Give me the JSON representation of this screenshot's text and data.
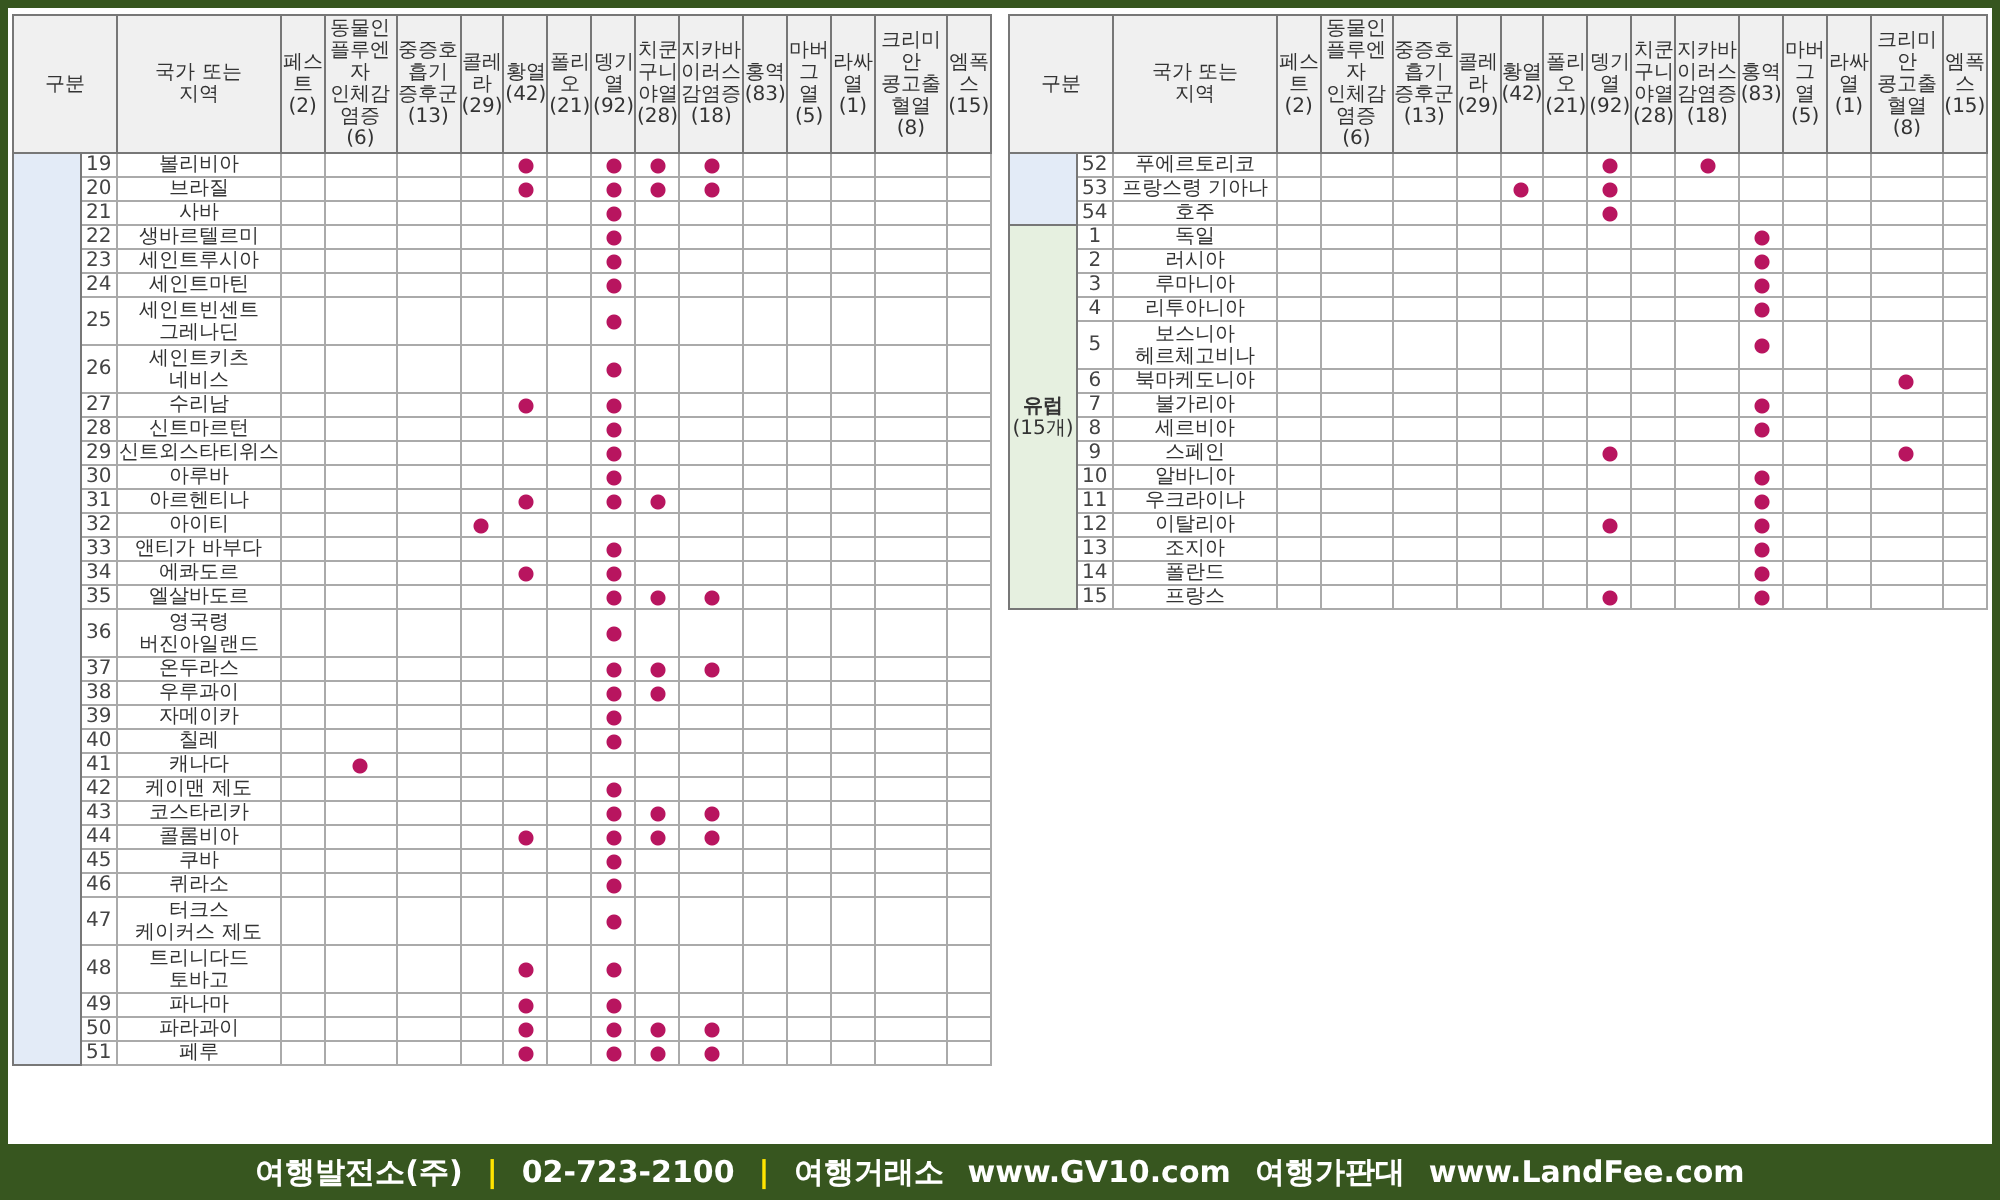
{
  "tables": [
    {
      "header": {
        "group": "구분",
        "region": [
          "국가 또는",
          "지역"
        ],
        "diseases": [
          {
            "name": [
              "페스트"
            ],
            "count": "(2)"
          },
          {
            "name": [
              "동물인플루엔자",
              "인체감염증"
            ],
            "count": "(6)"
          },
          {
            "name": [
              "중증호흡기",
              "증후군"
            ],
            "count": "(13)"
          },
          {
            "name": [
              "콜레라"
            ],
            "count": "(29)"
          },
          {
            "name": [
              "황열"
            ],
            "count": "(42)"
          },
          {
            "name": [
              "폴리오"
            ],
            "count": "(21)"
          },
          {
            "name": [
              "뎅기열"
            ],
            "count": "(92)"
          },
          {
            "name": [
              "치쿤",
              "구니야열"
            ],
            "count": "(28)"
          },
          {
            "name": [
              "지카바이러스",
              "감염증"
            ],
            "count": "(18)"
          },
          {
            "name": [
              "홍역"
            ],
            "count": "(83)"
          },
          {
            "name": [
              "마버그",
              "열"
            ],
            "count": "(5)"
          },
          {
            "name": [
              "라싸열"
            ],
            "count": "(1)"
          },
          {
            "name": [
              "크리미안",
              "콩고출혈열"
            ],
            "count": "(8)"
          },
          {
            "name": [
              "엠폭스"
            ],
            "count": "(15)"
          }
        ]
      },
      "groups": [
        {
          "color": "#e3ebf7",
          "rows": [
            {
              "no": "19",
              "region": [
                "볼리비아"
              ],
              "marked": [
                false,
                false,
                false,
                false,
                true,
                false,
                true,
                true,
                true,
                false,
                false,
                false,
                false,
                false
              ]
            },
            {
              "no": "20",
              "region": [
                "브라질"
              ],
              "marked": [
                false,
                false,
                false,
                false,
                true,
                false,
                true,
                true,
                true,
                false,
                false,
                false,
                false,
                false
              ]
            },
            {
              "no": "21",
              "region": [
                "사바"
              ],
              "marked": [
                false,
                false,
                false,
                false,
                false,
                false,
                true,
                false,
                false,
                false,
                false,
                false,
                false,
                false
              ]
            },
            {
              "no": "22",
              "region": [
                "생바르텔르미"
              ],
              "marked": [
                false,
                false,
                false,
                false,
                false,
                false,
                true,
                false,
                false,
                false,
                false,
                false,
                false,
                false
              ]
            },
            {
              "no": "23",
              "region": [
                "세인트루시아"
              ],
              "marked": [
                false,
                false,
                false,
                false,
                false,
                false,
                true,
                false,
                false,
                false,
                false,
                false,
                false,
                false
              ]
            },
            {
              "no": "24",
              "region": [
                "세인트마틴"
              ],
              "marked": [
                false,
                false,
                false,
                false,
                false,
                false,
                true,
                false,
                false,
                false,
                false,
                false,
                false,
                false
              ]
            },
            {
              "no": "25",
              "region": [
                "세인트빈센트",
                "그레나딘"
              ],
              "marked": [
                false,
                false,
                false,
                false,
                false,
                false,
                true,
                false,
                false,
                false,
                false,
                false,
                false,
                false
              ]
            },
            {
              "no": "26",
              "region": [
                "세인트키츠",
                "네비스"
              ],
              "marked": [
                false,
                false,
                false,
                false,
                false,
                false,
                true,
                false,
                false,
                false,
                false,
                false,
                false,
                false
              ]
            },
            {
              "no": "27",
              "region": [
                "수리남"
              ],
              "marked": [
                false,
                false,
                false,
                false,
                true,
                false,
                true,
                false,
                false,
                false,
                false,
                false,
                false,
                false
              ]
            },
            {
              "no": "28",
              "region": [
                "신트마르턴"
              ],
              "marked": [
                false,
                false,
                false,
                false,
                false,
                false,
                true,
                false,
                false,
                false,
                false,
                false,
                false,
                false
              ]
            },
            {
              "no": "29",
              "region": [
                "신트외스타티위스"
              ],
              "marked": [
                false,
                false,
                false,
                false,
                false,
                false,
                true,
                false,
                false,
                false,
                false,
                false,
                false,
                false
              ]
            },
            {
              "no": "30",
              "region": [
                "아루바"
              ],
              "marked": [
                false,
                false,
                false,
                false,
                false,
                false,
                true,
                false,
                false,
                false,
                false,
                false,
                false,
                false
              ]
            },
            {
              "no": "31",
              "region": [
                "아르헨티나"
              ],
              "marked": [
                false,
                false,
                false,
                false,
                true,
                false,
                true,
                true,
                false,
                false,
                false,
                false,
                false,
                false
              ]
            },
            {
              "no": "32",
              "region": [
                "아이티"
              ],
              "marked": [
                false,
                false,
                false,
                true,
                false,
                false,
                false,
                false,
                false,
                false,
                false,
                false,
                false,
                false
              ]
            },
            {
              "no": "33",
              "region": [
                "앤티가 바부다"
              ],
              "marked": [
                false,
                false,
                false,
                false,
                false,
                false,
                true,
                false,
                false,
                false,
                false,
                false,
                false,
                false
              ]
            },
            {
              "no": "34",
              "region": [
                "에콰도르"
              ],
              "marked": [
                false,
                false,
                false,
                false,
                true,
                false,
                true,
                false,
                false,
                false,
                false,
                false,
                false,
                false
              ]
            },
            {
              "no": "35",
              "region": [
                "엘살바도르"
              ],
              "marked": [
                false,
                false,
                false,
                false,
                false,
                false,
                true,
                true,
                true,
                false,
                false,
                false,
                false,
                false
              ]
            },
            {
              "no": "36",
              "region": [
                "영국령",
                "버진아일랜드"
              ],
              "marked": [
                false,
                false,
                false,
                false,
                false,
                false,
                true,
                false,
                false,
                false,
                false,
                false,
                false,
                false
              ]
            },
            {
              "no": "37",
              "region": [
                "온두라스"
              ],
              "marked": [
                false,
                false,
                false,
                false,
                false,
                false,
                true,
                true,
                true,
                false,
                false,
                false,
                false,
                false
              ]
            },
            {
              "no": "38",
              "region": [
                "우루과이"
              ],
              "marked": [
                false,
                false,
                false,
                false,
                false,
                false,
                true,
                true,
                false,
                false,
                false,
                false,
                false,
                false
              ]
            },
            {
              "no": "39",
              "region": [
                "자메이카"
              ],
              "marked": [
                false,
                false,
                false,
                false,
                false,
                false,
                true,
                false,
                false,
                false,
                false,
                false,
                false,
                false
              ]
            },
            {
              "no": "40",
              "region": [
                "칠레"
              ],
              "marked": [
                false,
                false,
                false,
                false,
                false,
                false,
                true,
                false,
                false,
                false,
                false,
                false,
                false,
                false
              ]
            },
            {
              "no": "41",
              "region": [
                "캐나다"
              ],
              "marked": [
                false,
                true,
                false,
                false,
                false,
                false,
                false,
                false,
                false,
                false,
                false,
                false,
                false,
                false
              ]
            },
            {
              "no": "42",
              "region": [
                "케이맨 제도"
              ],
              "marked": [
                false,
                false,
                false,
                false,
                false,
                false,
                true,
                false,
                false,
                false,
                false,
                false,
                false,
                false
              ]
            },
            {
              "no": "43",
              "region": [
                "코스타리카"
              ],
              "marked": [
                false,
                false,
                false,
                false,
                false,
                false,
                true,
                true,
                true,
                false,
                false,
                false,
                false,
                false
              ]
            },
            {
              "no": "44",
              "region": [
                "콜롬비아"
              ],
              "marked": [
                false,
                false,
                false,
                false,
                true,
                false,
                true,
                true,
                true,
                false,
                false,
                false,
                false,
                false
              ]
            },
            {
              "no": "45",
              "region": [
                "쿠바"
              ],
              "marked": [
                false,
                false,
                false,
                false,
                false,
                false,
                true,
                false,
                false,
                false,
                false,
                false,
                false,
                false
              ]
            },
            {
              "no": "46",
              "region": [
                "퀴라소"
              ],
              "marked": [
                false,
                false,
                false,
                false,
                false,
                false,
                true,
                false,
                false,
                false,
                false,
                false,
                false,
                false
              ]
            },
            {
              "no": "47",
              "region": [
                "터크스",
                "케이커스 제도"
              ],
              "marked": [
                false,
                false,
                false,
                false,
                false,
                false,
                true,
                false,
                false,
                false,
                false,
                false,
                false,
                false
              ]
            },
            {
              "no": "48",
              "region": [
                "트리니다드",
                "토바고"
              ],
              "marked": [
                false,
                false,
                false,
                false,
                true,
                false,
                true,
                false,
                false,
                false,
                false,
                false,
                false,
                false
              ]
            },
            {
              "no": "49",
              "region": [
                "파나마"
              ],
              "marked": [
                false,
                false,
                false,
                false,
                true,
                false,
                true,
                false,
                false,
                false,
                false,
                false,
                false,
                false
              ]
            },
            {
              "no": "50",
              "region": [
                "파라과이"
              ],
              "marked": [
                false,
                false,
                false,
                false,
                true,
                false,
                true,
                true,
                true,
                false,
                false,
                false,
                false,
                false
              ]
            },
            {
              "no": "51",
              "region": [
                "페루"
              ],
              "marked": [
                false,
                false,
                false,
                false,
                true,
                false,
                true,
                true,
                true,
                false,
                false,
                false,
                false,
                false
              ]
            }
          ]
        }
      ]
    },
    {
      "header": {
        "group": "구분",
        "region": [
          "국가 또는",
          "지역"
        ],
        "diseases": [
          {
            "name": [
              "페스트"
            ],
            "count": "(2)"
          },
          {
            "name": [
              "동물인플루엔자",
              "인체감염증"
            ],
            "count": "(6)"
          },
          {
            "name": [
              "중증호흡기",
              "증후군"
            ],
            "count": "(13)"
          },
          {
            "name": [
              "콜레라"
            ],
            "count": "(29)"
          },
          {
            "name": [
              "황열"
            ],
            "count": "(42)"
          },
          {
            "name": [
              "폴리오"
            ],
            "count": "(21)"
          },
          {
            "name": [
              "뎅기열"
            ],
            "count": "(92)"
          },
          {
            "name": [
              "치쿤",
              "구니야열"
            ],
            "count": "(28)"
          },
          {
            "name": [
              "지카바이러스",
              "감염증"
            ],
            "count": "(18)"
          },
          {
            "name": [
              "홍역"
            ],
            "count": "(83)"
          },
          {
            "name": [
              "마버그",
              "열"
            ],
            "count": "(5)"
          },
          {
            "name": [
              "라싸열"
            ],
            "count": "(1)"
          },
          {
            "name": [
              "크리미안",
              "콩고출혈열"
            ],
            "count": "(8)"
          },
          {
            "name": [
              "엠폭스"
            ],
            "count": "(15)"
          }
        ]
      },
      "groups": [
        {
          "color": "#e3ebf7",
          "rows": [
            {
              "no": "52",
              "region": [
                "푸에르토리코"
              ],
              "marked": [
                false,
                false,
                false,
                false,
                false,
                false,
                true,
                false,
                true,
                false,
                false,
                false,
                false,
                false
              ]
            },
            {
              "no": "53",
              "region": [
                "프랑스령 기아나"
              ],
              "marked": [
                false,
                false,
                false,
                false,
                true,
                false,
                true,
                false,
                false,
                false,
                false,
                false,
                false,
                false
              ]
            },
            {
              "no": "54",
              "region": [
                "호주"
              ],
              "marked": [
                false,
                false,
                false,
                false,
                false,
                false,
                true,
                false,
                false,
                false,
                false,
                false,
                false,
                false
              ]
            }
          ]
        },
        {
          "color": "#e6f0e0",
          "label": "유럽",
          "sublabel": "(15개)",
          "rows": [
            {
              "no": "1",
              "region": [
                "독일"
              ],
              "marked": [
                false,
                false,
                false,
                false,
                false,
                false,
                false,
                false,
                false,
                true,
                false,
                false,
                false,
                false
              ]
            },
            {
              "no": "2",
              "region": [
                "러시아"
              ],
              "marked": [
                false,
                false,
                false,
                false,
                false,
                false,
                false,
                false,
                false,
                true,
                false,
                false,
                false,
                false
              ]
            },
            {
              "no": "3",
              "region": [
                "루마니아"
              ],
              "marked": [
                false,
                false,
                false,
                false,
                false,
                false,
                false,
                false,
                false,
                true,
                false,
                false,
                false,
                false
              ]
            },
            {
              "no": "4",
              "region": [
                "리투아니아"
              ],
              "marked": [
                false,
                false,
                false,
                false,
                false,
                false,
                false,
                false,
                false,
                true,
                false,
                false,
                false,
                false
              ]
            },
            {
              "no": "5",
              "region": [
                "보스니아",
                "헤르체고비나"
              ],
              "marked": [
                false,
                false,
                false,
                false,
                false,
                false,
                false,
                false,
                false,
                true,
                false,
                false,
                false,
                false
              ]
            },
            {
              "no": "6",
              "region": [
                "북마케도니아"
              ],
              "marked": [
                false,
                false,
                false,
                false,
                false,
                false,
                false,
                false,
                false,
                false,
                false,
                false,
                true,
                false
              ]
            },
            {
              "no": "7",
              "region": [
                "불가리아"
              ],
              "marked": [
                false,
                false,
                false,
                false,
                false,
                false,
                false,
                false,
                false,
                true,
                false,
                false,
                false,
                false
              ]
            },
            {
              "no": "8",
              "region": [
                "세르비아"
              ],
              "marked": [
                false,
                false,
                false,
                false,
                false,
                false,
                false,
                false,
                false,
                true,
                false,
                false,
                false,
                false
              ]
            },
            {
              "no": "9",
              "region": [
                "스페인"
              ],
              "marked": [
                false,
                false,
                false,
                false,
                false,
                false,
                true,
                false,
                false,
                false,
                false,
                false,
                true,
                false
              ]
            },
            {
              "no": "10",
              "region": [
                "알바니아"
              ],
              "marked": [
                false,
                false,
                false,
                false,
                false,
                false,
                false,
                false,
                false,
                true,
                false,
                false,
                false,
                false
              ]
            },
            {
              "no": "11",
              "region": [
                "우크라이나"
              ],
              "marked": [
                false,
                false,
                false,
                false,
                false,
                false,
                false,
                false,
                false,
                true,
                false,
                false,
                false,
                false
              ]
            },
            {
              "no": "12",
              "region": [
                "이탈리아"
              ],
              "marked": [
                false,
                false,
                false,
                false,
                false,
                false,
                true,
                false,
                false,
                true,
                false,
                false,
                false,
                false
              ]
            },
            {
              "no": "13",
              "region": [
                "조지아"
              ],
              "marked": [
                false,
                false,
                false,
                false,
                false,
                false,
                false,
                false,
                false,
                true,
                false,
                false,
                false,
                false
              ]
            },
            {
              "no": "14",
              "region": [
                "폴란드"
              ],
              "marked": [
                false,
                false,
                false,
                false,
                false,
                false,
                false,
                false,
                false,
                true,
                false,
                false,
                false,
                false
              ]
            },
            {
              "no": "15",
              "region": [
                "프랑스"
              ],
              "marked": [
                false,
                false,
                false,
                false,
                false,
                false,
                true,
                false,
                false,
                true,
                false,
                false,
                false,
                false
              ]
            }
          ]
        }
      ]
    }
  ],
  "footer": [
    {
      "kind": "text",
      "text": "여행발전소(주)"
    },
    {
      "kind": "separator",
      "text": "|"
    },
    {
      "kind": "text",
      "text": "02-723-2100"
    },
    {
      "kind": "separator",
      "text": "|"
    },
    {
      "kind": "text",
      "text": "여행거래소"
    },
    {
      "kind": "text",
      "text": "www.GV10.com"
    },
    {
      "kind": "text",
      "text": "여행가판대"
    },
    {
      "kind": "text",
      "text": "www.LandFee.com"
    }
  ]
}
